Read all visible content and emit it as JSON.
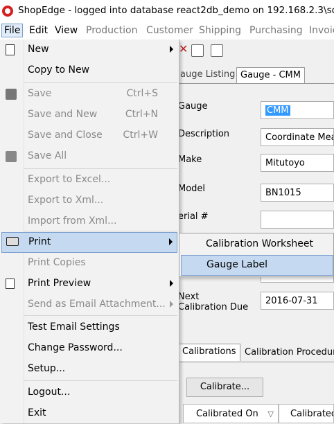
{
  "window": {
    "title": "ShopEdge -  logged into database react2db_demo on 192.168.2.3\\sq"
  },
  "menubar": {
    "items": [
      "File",
      "Edit",
      "View",
      "Production",
      "Customer",
      "Shipping",
      "Purchasing",
      "Invoic"
    ]
  },
  "form": {
    "tabs": [
      "auge Listing",
      "Gauge - CMM"
    ],
    "labels": {
      "gauge": "Gauge",
      "description": "Description",
      "make": "Make",
      "model": "Model",
      "serial": "erial #",
      "next_due": "Next\nCalibration Due"
    },
    "values": {
      "gauge": "CMM",
      "description": "Coordinate Mea",
      "make": "Mitutoyo",
      "model": "BN1015",
      "serial": "",
      "next_due": "2016-07-31"
    },
    "subtabs": [
      "Calibrations",
      "Calibration Procedure"
    ],
    "calibrate_button": "Calibrate...",
    "columns": [
      "Calibrated On",
      "Calibrated"
    ]
  },
  "file_menu": {
    "items": [
      {
        "label": "New",
        "submenu": true
      },
      {
        "label": "Copy to New"
      },
      {
        "label": "Save",
        "shortcut": "Ctrl+S",
        "disabled": true
      },
      {
        "label": "Save and New",
        "shortcut": "Ctrl+N",
        "disabled": true
      },
      {
        "label": "Save and Close",
        "shortcut": "Ctrl+W",
        "disabled": true
      },
      {
        "label": "Save All",
        "disabled": true
      },
      {
        "label": "Export to Excel...",
        "disabled": true
      },
      {
        "label": "Export to Xml...",
        "disabled": true
      },
      {
        "label": "Import from Xml...",
        "disabled": true
      },
      {
        "label": "Print",
        "submenu": true,
        "highlighted": true
      },
      {
        "label": "Print Copies",
        "disabled": true
      },
      {
        "label": "Print Preview",
        "submenu": true
      },
      {
        "label": "Send as Email Attachment...",
        "submenu": true,
        "disabled": true
      },
      {
        "label": "Test Email Settings"
      },
      {
        "label": "Change Password..."
      },
      {
        "label": "Setup..."
      },
      {
        "label": "Logout..."
      },
      {
        "label": "Exit"
      }
    ]
  },
  "print_submenu": {
    "items": [
      "Calibration Worksheet",
      "Gauge Label"
    ]
  },
  "colors": {
    "highlight": "#c5d9f1",
    "highlight_border": "#7ca0d0",
    "selection": "#3399ff",
    "logo": "#d42020"
  }
}
